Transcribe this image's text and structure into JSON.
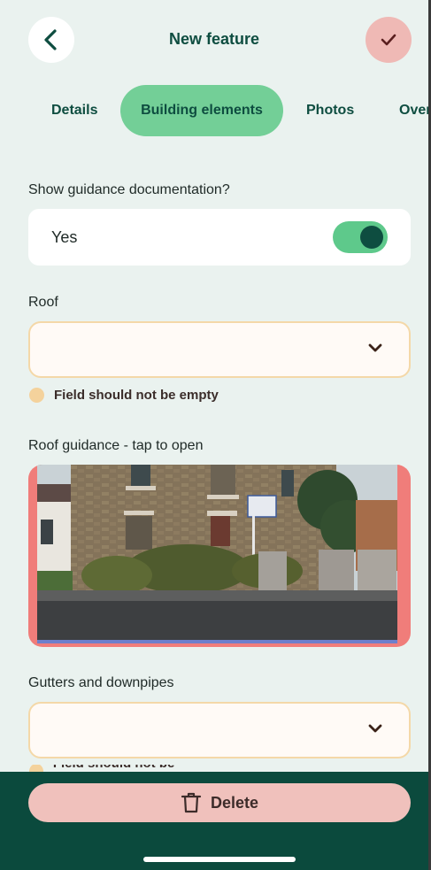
{
  "header": {
    "title": "New feature"
  },
  "tabs": [
    {
      "label": "Details"
    },
    {
      "label": "Building elements"
    },
    {
      "label": "Photos"
    },
    {
      "label": "Overview"
    }
  ],
  "guidance_toggle": {
    "label": "Show guidance documentation?",
    "value_text": "Yes",
    "enabled": true
  },
  "roof": {
    "label": "Roof",
    "selected_value": "",
    "error": "Field should not be empty"
  },
  "roof_guidance": {
    "label": "Roof guidance - tap to open"
  },
  "gutters": {
    "label": "Gutters and downpipes",
    "selected_value": "",
    "error": "Field should not be empty"
  },
  "footer": {
    "delete_label": "Delete"
  },
  "colors": {
    "primary": "#0e4d40",
    "active_tab": "#73cf97",
    "toggle_track": "#5ec98b",
    "confirm_button": "#efb9b5",
    "delete_button": "#f0c1bc",
    "error_border": "#f4d8a8",
    "image_frame": "#f07d7a"
  },
  "icons": {
    "back": "chevron-left-icon",
    "confirm": "checkmark-icon",
    "dropdown": "chevron-down-icon",
    "warning": "warning-circle-icon",
    "delete": "trash-icon"
  }
}
